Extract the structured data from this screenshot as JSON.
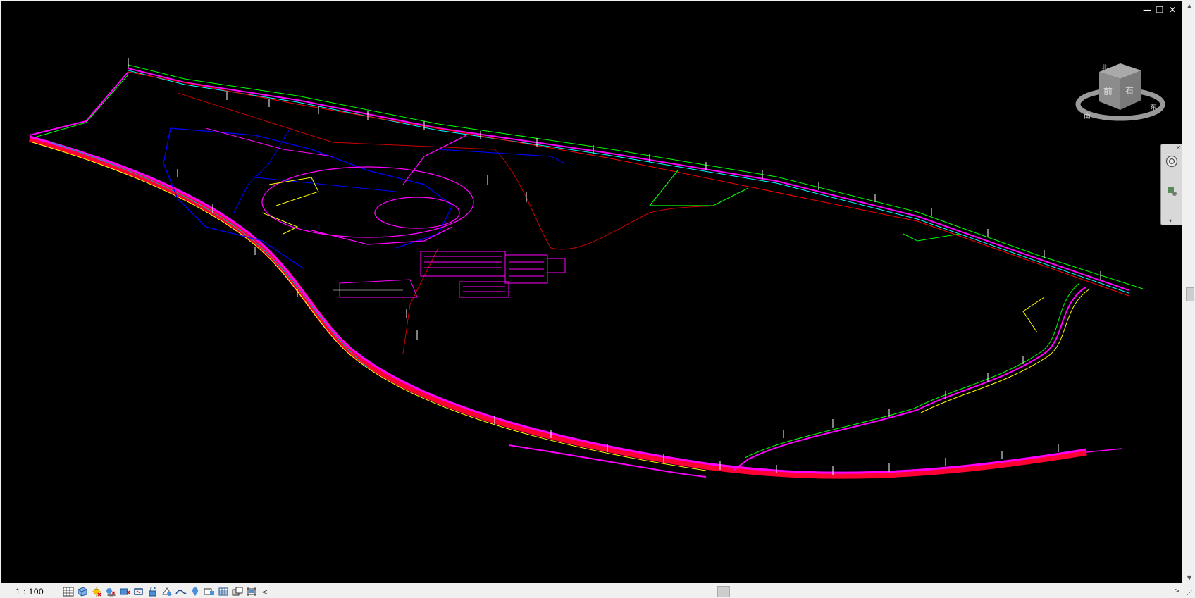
{
  "window_controls": {
    "minimize": "—",
    "restore": "❐",
    "close": "✕"
  },
  "viewcube": {
    "face_front": "前",
    "face_right": "右",
    "ring_left": "南",
    "ring_right": "东",
    "ring_top": "北"
  },
  "navbar": {
    "close": "×",
    "dropdown": "▾"
  },
  "statusbar": {
    "scale": "1 : 100"
  },
  "tools": [
    {
      "name": "detail-level-icon"
    },
    {
      "name": "visual-style-icon"
    },
    {
      "name": "sun-path-icon"
    },
    {
      "name": "shadows-icon"
    },
    {
      "name": "crop-view-icon"
    },
    {
      "name": "show-crop-icon"
    },
    {
      "name": "unlock-3d-icon"
    },
    {
      "name": "temporary-hide-icon"
    },
    {
      "name": "reveal-hidden-icon"
    },
    {
      "name": "analysis-icon"
    },
    {
      "name": "highlight-icon"
    },
    {
      "name": "display-constraints-icon"
    },
    {
      "name": "worksharing-icon"
    },
    {
      "name": "design-options-icon"
    }
  ],
  "hscroll_left": "<",
  "hscroll_right": ">",
  "colors": {
    "background": "#000000",
    "pipe_main": "#ff00ff",
    "pipe_red": "#ff0033",
    "pipe_green": "#00ff00",
    "pipe_blue": "#0000ff",
    "pipe_yellow": "#ffff00"
  }
}
